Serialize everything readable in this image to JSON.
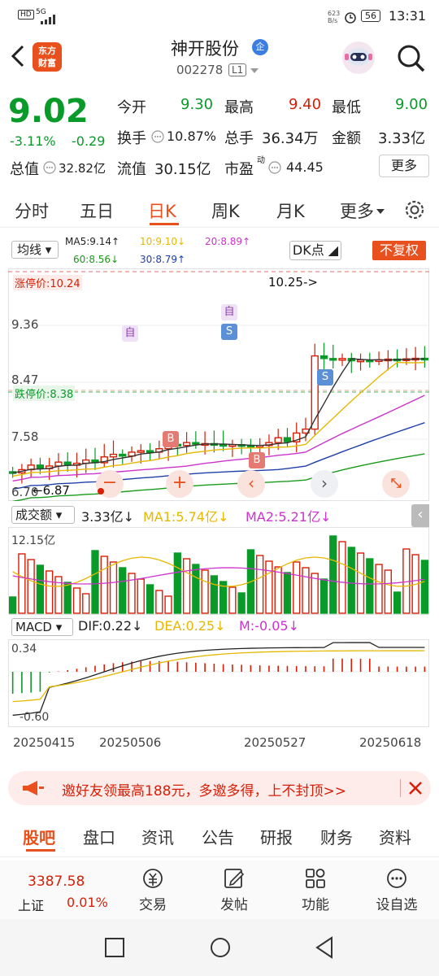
{
  "status": {
    "network": "5G",
    "hd": "HD",
    "speed": "623\nB/s",
    "battery": "56",
    "time": "13:31"
  },
  "header": {
    "logo_line1": "东方",
    "logo_line2": "财富",
    "stock_name": "神开股份",
    "stock_tag": "企",
    "stock_code": "002278",
    "board": "L1"
  },
  "quote": {
    "price": "9.02",
    "change_pct": "-3.11%",
    "change": "-0.29",
    "open_label": "今开",
    "open": "9.30",
    "high_label": "最高",
    "high": "9.40",
    "low_label": "最低",
    "low": "9.00",
    "turnover_label": "换手",
    "turnover": "10.87%",
    "volume_label": "总手",
    "volume": "36.34万",
    "amount_label": "金额",
    "amount": "3.33亿",
    "mcap_label": "总值",
    "mcap": "32.82亿",
    "float_label": "流值",
    "float_cap": "30.15亿",
    "pe_label": "市盈",
    "pe_sup": "动",
    "pe": "44.45",
    "more_label": "更多"
  },
  "period_tabs": [
    "分时",
    "五日",
    "日K",
    "周K",
    "月K",
    "更多"
  ],
  "active_period": "日K",
  "ma": {
    "type_label": "均线",
    "ma5": "MA5:9.14↑",
    "ma10": "10:9.10↓",
    "ma20": "20:8.89↑",
    "ma60": "60:8.56↓",
    "ma30": "30:8.79↑",
    "dk_label": "DK点",
    "fq_label": "不复权",
    "ma5_color": "#333333",
    "ma10_color": "#e6b800",
    "ma20_color": "#cc33cc",
    "ma30_color": "#1f3fa8",
    "ma60_color": "#1a9a1a"
  },
  "kline": {
    "limit_up": "涨停价:10.24",
    "limit_down": "跌停价:8.38",
    "y_9_36": "9.36",
    "y_8_47": "8.47",
    "y_7_58": "7.58",
    "y_6_70": "6.70",
    "high_note": "10.25->",
    "low_note": "←6.87",
    "tag_self": "自",
    "tag_s": "S",
    "tag_b": "B"
  },
  "volume": {
    "type_label": "成交额",
    "value": "3.33亿↓",
    "ma1": "MA1:5.74亿↓",
    "ma2": "MA2:5.21亿↓",
    "top": "12.15亿"
  },
  "macd": {
    "type_label": "MACD",
    "dif": "DIF:0.22↓",
    "dea": "DEA:0.25↓",
    "m": "M:-0.05↓",
    "top": "0.34",
    "bottom": "-0.60"
  },
  "dates": [
    "20250415",
    "20250506",
    "20250527",
    "20250618"
  ],
  "banner": {
    "text": "邀好友领最高188元，多邀多得，上不封顶>>"
  },
  "bottom_tabs": [
    "股吧",
    "盘口",
    "资讯",
    "公告",
    "研报",
    "财务",
    "资料"
  ],
  "index": {
    "value": "3387.58",
    "name": "上证",
    "change": "0.01%"
  },
  "footer_items": [
    "交易",
    "发帖",
    "功能",
    "设自选"
  ],
  "colors": {
    "up": "#d81e06",
    "down": "#0a9a2a",
    "accent": "#e8501e"
  }
}
